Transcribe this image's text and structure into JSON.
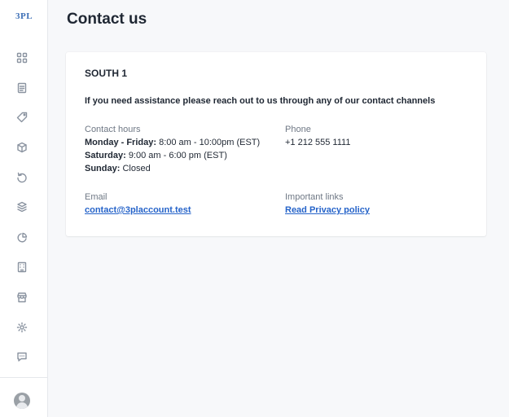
{
  "sidebar": {
    "logo": "3PL",
    "items": [
      {
        "icon": "grid-icon"
      },
      {
        "icon": "document-icon"
      },
      {
        "icon": "tag-icon"
      },
      {
        "icon": "box-icon"
      },
      {
        "icon": "refresh-icon"
      },
      {
        "icon": "stack-icon"
      },
      {
        "icon": "pie-chart-icon"
      },
      {
        "icon": "building-icon"
      },
      {
        "icon": "store-icon"
      },
      {
        "icon": "gear-icon"
      },
      {
        "icon": "chat-icon"
      }
    ]
  },
  "page": {
    "title": "Contact us"
  },
  "card": {
    "region": "SOUTH 1",
    "intro": "If you need assistance please reach out to us through any of our contact channels",
    "hours": {
      "label": "Contact hours",
      "weekdays_day": "Monday - Friday:",
      "weekdays_time": "8:00 am - 10:00pm (EST)",
      "saturday_day": "Saturday:",
      "saturday_time": "9:00 am - 6:00 pm (EST)",
      "sunday_day": "Sunday:",
      "sunday_time": "Closed"
    },
    "phone": {
      "label": "Phone",
      "value": "+1 212 555 1111"
    },
    "email": {
      "label": "Email",
      "value": "contact@3placcount.test"
    },
    "links": {
      "label": "Important links",
      "privacy": "Read Privacy policy"
    }
  },
  "colors": {
    "accent_link": "#2563c9",
    "background": "#f7f8fa",
    "card": "#ffffff",
    "muted_text": "#6f7885"
  }
}
